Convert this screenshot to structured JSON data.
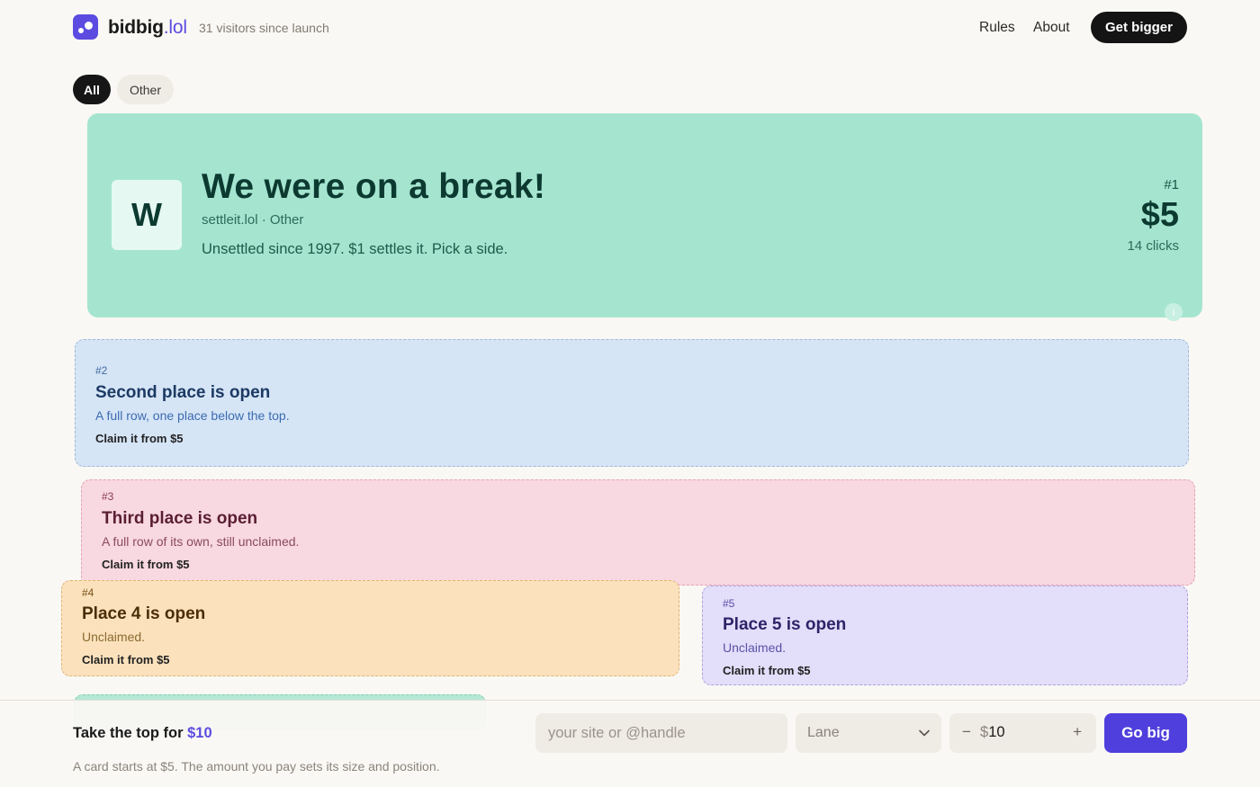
{
  "header": {
    "brand_name": "bidbig",
    "brand_tld": ".lol",
    "visitors": "31 visitors since launch",
    "nav": {
      "rules": "Rules",
      "about": "About"
    },
    "cta": "Get bigger"
  },
  "filters": {
    "all": "All",
    "other": "Other"
  },
  "top_card": {
    "avatar_letter": "W",
    "title": "We were on a break!",
    "meta": "settleit.lol · Other",
    "description": "Unsettled since 1997. $1 settles it. Pick a side.",
    "rank": "#1",
    "price": "$5",
    "clicks": "14 clicks",
    "info_icon": "i"
  },
  "slots": [
    {
      "rank": "#2",
      "title": "Second place is open",
      "desc": "A full row, one place below the top.",
      "claim": "Claim it from $5"
    },
    {
      "rank": "#3",
      "title": "Third place is open",
      "desc": "A full row of its own, still unclaimed.",
      "claim": "Claim it from $5"
    },
    {
      "rank": "#4",
      "title": "Place 4 is open",
      "desc": "Unclaimed.",
      "claim": "Claim it from $5"
    },
    {
      "rank": "#5",
      "title": "Place 5 is open",
      "desc": "Unclaimed.",
      "claim": "Claim it from $5"
    }
  ],
  "bottom_bar": {
    "title_prefix": "Take the top for ",
    "title_amount": "$10",
    "subtitle": "A card starts at $5. The amount you pay sets its size and position.",
    "handle_placeholder": "your site or @handle",
    "lane_label": "Lane",
    "minus": "−",
    "currency": "$",
    "amount": "10",
    "plus": "+",
    "go_label": "Go big"
  },
  "colors": {
    "accent": "#5b4be0",
    "top_card": "#a5e5d0",
    "slot2": "#d6e5f6",
    "slot3": "#f8d8e1",
    "slot4": "#fbe2bd",
    "slot5": "#e3defa"
  }
}
